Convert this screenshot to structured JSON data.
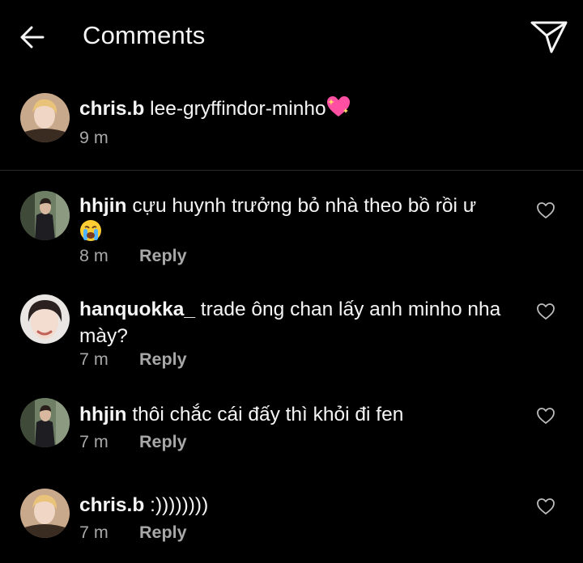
{
  "header": {
    "title": "Comments",
    "back_icon": "arrow-left-icon",
    "send_icon": "paper-plane-icon"
  },
  "caption": {
    "username": "chris.b",
    "text": "lee-gryffindor-minho",
    "emoji": "sparkling-heart-emoji",
    "time": "9 m"
  },
  "comments": [
    {
      "username": "hhjin",
      "text": "cựu huynh trưởng bỏ nhà theo bồ rồi ư",
      "emoji": "loudly-crying-face-emoji",
      "time": "8 m",
      "reply_label": "Reply"
    },
    {
      "username": "hanquokka_",
      "text": "trade ông chan lấy anh minho nha mày?",
      "time": "7 m",
      "reply_label": "Reply"
    },
    {
      "username": "hhjin",
      "text": "thôi chắc cái đấy thì khỏi đi fen",
      "time": "7 m",
      "reply_label": "Reply"
    },
    {
      "username": "chris.b",
      "text": ":))))))))",
      "time": "7 m",
      "reply_label": "Reply"
    }
  ],
  "colors": {
    "background": "#000000",
    "text_primary": "#f5f5f5",
    "text_secondary": "#a8a8a8",
    "divider": "#2a2a2a"
  }
}
